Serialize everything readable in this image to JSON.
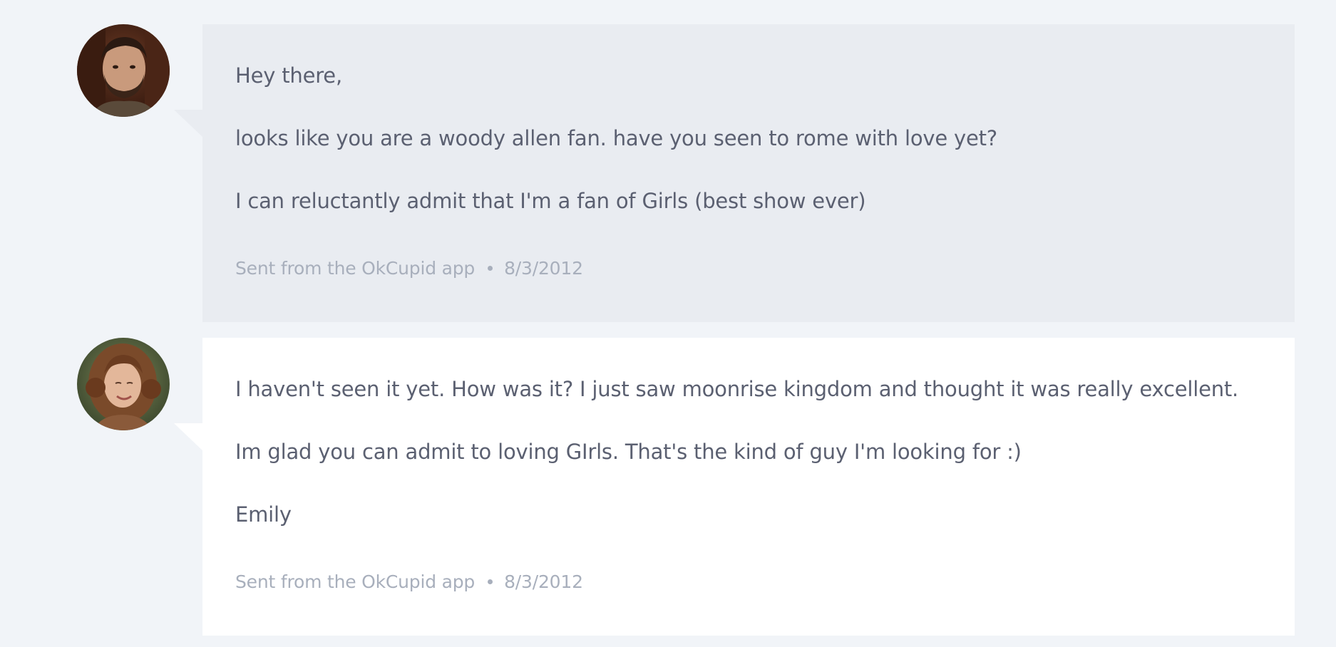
{
  "messages": [
    {
      "sender": "them",
      "avatar": "man-avatar",
      "paragraphs": [
        "Hey there,",
        "looks like you are a woody allen fan. have you seen to rome with love yet?",
        "I can reluctantly admit that I'm a fan of Girls (best show ever)"
      ],
      "source": "Sent from the OkCupid app",
      "date": "8/3/2012"
    },
    {
      "sender": "me",
      "avatar": "woman-avatar",
      "paragraphs": [
        "I haven't seen it yet. How was it? I just saw moonrise kingdom and thought it was really excellent.",
        "Im glad you can admit to loving GIrls. That's the kind of guy I'm looking for :)",
        "Emily"
      ],
      "source": "Sent from the OkCupid app",
      "date": "8/3/2012"
    }
  ],
  "colors": {
    "page_background": "#f1f4f8",
    "received_bubble": "#e9ecf1",
    "sent_bubble": "#ffffff",
    "body_text": "#5b6071",
    "meta_text": "#a8afbc"
  }
}
